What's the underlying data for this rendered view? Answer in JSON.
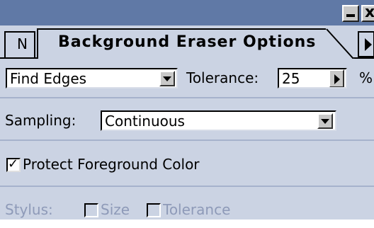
{
  "window": {
    "minimize_icon": "minimize-icon",
    "close_glyph": "x"
  },
  "tabs": {
    "hidden_tab_label": "N",
    "active_tab_label": "Background Eraser Options",
    "scroll_icon": "right-arrow-icon"
  },
  "options": {
    "limits_mode": "Find Edges",
    "tolerance_label": "Tolerance:",
    "tolerance_value": "25",
    "tolerance_unit": "%",
    "sampling_label": "Sampling:",
    "sampling_value": "Continuous",
    "protect_label": "Protect Foreground Color",
    "protect_checked": true,
    "stylus_label": "Stylus:",
    "stylus_size_label": "Size",
    "stylus_tolerance_label": "Tolerance",
    "stylus_size_checked": false,
    "stylus_tolerance_checked": false
  },
  "colors": {
    "title_bar": "#6079a6",
    "panel_bg": "#cbd3e3",
    "disabled_text": "#8e9ab8"
  }
}
